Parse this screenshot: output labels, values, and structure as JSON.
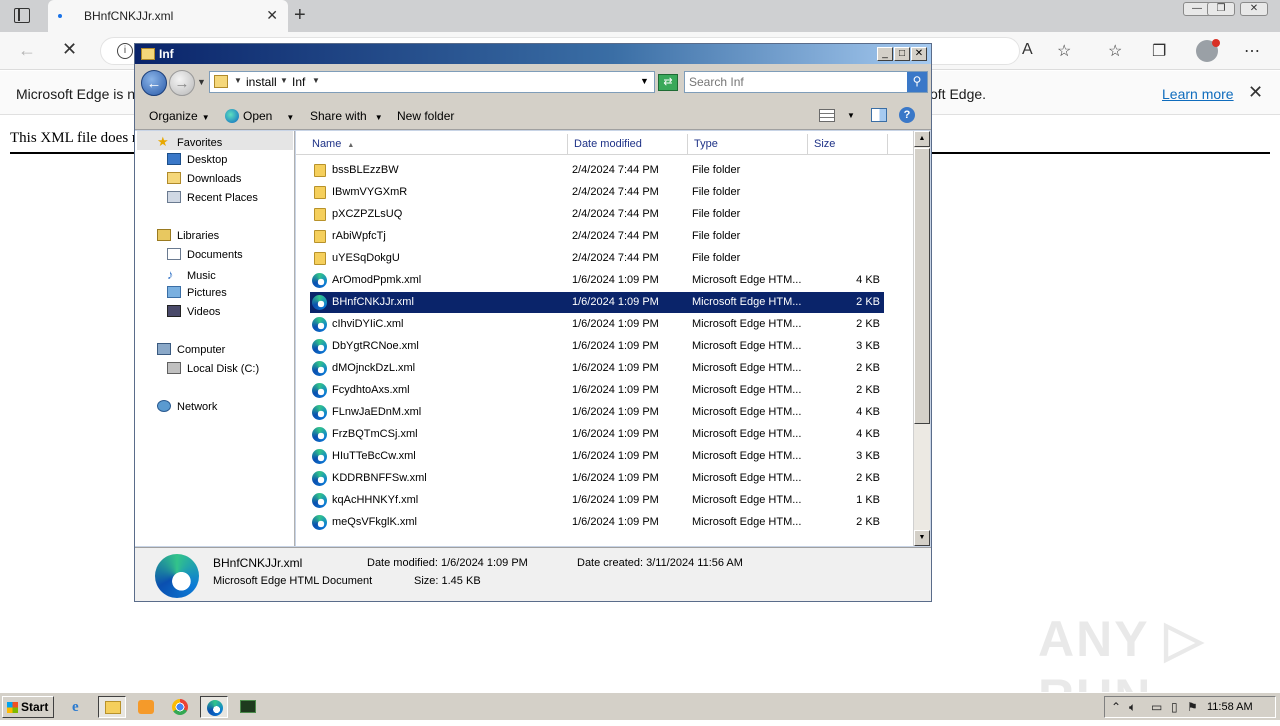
{
  "browser": {
    "tab_title": "BHnfCNKJJr.xml",
    "tab_close": "✕",
    "new_tab": "+",
    "win_controls": [
      "—",
      "❐",
      "✕"
    ],
    "infobar_message": "Microsoft Edge is no",
    "infobar_message_end": "oft Edge.",
    "learn_more": "Learn more",
    "infobar_close": "✕"
  },
  "page": {
    "xml_message": "This XML file does n",
    "watermark": "ANY ▷ RUN"
  },
  "explorer": {
    "title": "Inf",
    "caption_buttons": [
      "_",
      "□",
      "✕"
    ],
    "path": [
      "install",
      "Inf"
    ],
    "search_placeholder": "Search Inf",
    "commands": {
      "organize": "Organize",
      "open": "Open",
      "share_with": "Share with",
      "new_folder": "New folder"
    },
    "nav_pane": {
      "favorites": "Favorites",
      "desktop": "Desktop",
      "downloads": "Downloads",
      "recent_places": "Recent Places",
      "libraries": "Libraries",
      "documents": "Documents",
      "music": "Music",
      "pictures": "Pictures",
      "videos": "Videos",
      "computer": "Computer",
      "local_disk": "Local Disk (C:)",
      "network": "Network"
    },
    "columns": {
      "name": "Name",
      "date_modified": "Date modified",
      "type": "Type",
      "size": "Size"
    },
    "files": [
      {
        "name": "bssBLEzzBW",
        "date": "2/4/2024 7:44 PM",
        "type": "File folder",
        "size": "",
        "kind": "folder"
      },
      {
        "name": "IBwmVYGXmR",
        "date": "2/4/2024 7:44 PM",
        "type": "File folder",
        "size": "",
        "kind": "folder"
      },
      {
        "name": "pXCZPZLsUQ",
        "date": "2/4/2024 7:44 PM",
        "type": "File folder",
        "size": "",
        "kind": "folder"
      },
      {
        "name": "rAbiWpfcTj",
        "date": "2/4/2024 7:44 PM",
        "type": "File folder",
        "size": "",
        "kind": "folder"
      },
      {
        "name": "uYESqDokgU",
        "date": "2/4/2024 7:44 PM",
        "type": "File folder",
        "size": "",
        "kind": "folder"
      },
      {
        "name": "ArOmodPpmk.xml",
        "date": "1/6/2024 1:09 PM",
        "type": "Microsoft Edge HTM...",
        "size": "4 KB",
        "kind": "edge"
      },
      {
        "name": "BHnfCNKJJr.xml",
        "date": "1/6/2024 1:09 PM",
        "type": "Microsoft Edge HTM...",
        "size": "2 KB",
        "kind": "edge",
        "selected": true
      },
      {
        "name": "cIhviDYIiC.xml",
        "date": "1/6/2024 1:09 PM",
        "type": "Microsoft Edge HTM...",
        "size": "2 KB",
        "kind": "edge"
      },
      {
        "name": "DbYgtRCNoe.xml",
        "date": "1/6/2024 1:09 PM",
        "type": "Microsoft Edge HTM...",
        "size": "3 KB",
        "kind": "edge"
      },
      {
        "name": "dMOjnckDzL.xml",
        "date": "1/6/2024 1:09 PM",
        "type": "Microsoft Edge HTM...",
        "size": "2 KB",
        "kind": "edge"
      },
      {
        "name": "FcydhtoAxs.xml",
        "date": "1/6/2024 1:09 PM",
        "type": "Microsoft Edge HTM...",
        "size": "2 KB",
        "kind": "edge"
      },
      {
        "name": "FLnwJaEDnM.xml",
        "date": "1/6/2024 1:09 PM",
        "type": "Microsoft Edge HTM...",
        "size": "4 KB",
        "kind": "edge"
      },
      {
        "name": "FrzBQTmCSj.xml",
        "date": "1/6/2024 1:09 PM",
        "type": "Microsoft Edge HTM...",
        "size": "4 KB",
        "kind": "edge"
      },
      {
        "name": "HIuTTeBcCw.xml",
        "date": "1/6/2024 1:09 PM",
        "type": "Microsoft Edge HTM...",
        "size": "3 KB",
        "kind": "edge"
      },
      {
        "name": "KDDRBNFFSw.xml",
        "date": "1/6/2024 1:09 PM",
        "type": "Microsoft Edge HTM...",
        "size": "2 KB",
        "kind": "edge"
      },
      {
        "name": "kqAcHHNKYf.xml",
        "date": "1/6/2024 1:09 PM",
        "type": "Microsoft Edge HTM...",
        "size": "1 KB",
        "kind": "edge"
      },
      {
        "name": "meQsVFkglK.xml",
        "date": "1/6/2024 1:09 PM",
        "type": "Microsoft Edge HTM...",
        "size": "2 KB",
        "kind": "edge"
      }
    ],
    "details": {
      "name": "BHnfCNKJJr.xml",
      "type": "Microsoft Edge HTML Document",
      "date_modified": "Date modified: 1/6/2024 1:09 PM",
      "size": "Size: 1.45 KB",
      "date_created": "Date created: 3/11/2024 11:56 AM"
    }
  },
  "taskbar": {
    "start": "Start",
    "apps": [
      "internet-explorer-icon",
      "explorer-folder-icon",
      "media-player-icon",
      "chrome-icon",
      "edge-icon",
      "terminal-icon"
    ],
    "clock": "11:58 AM"
  },
  "colors": {
    "selection": "#0a246a",
    "title_gradient_start": "#0a246a",
    "link": "#0f6cbd"
  }
}
